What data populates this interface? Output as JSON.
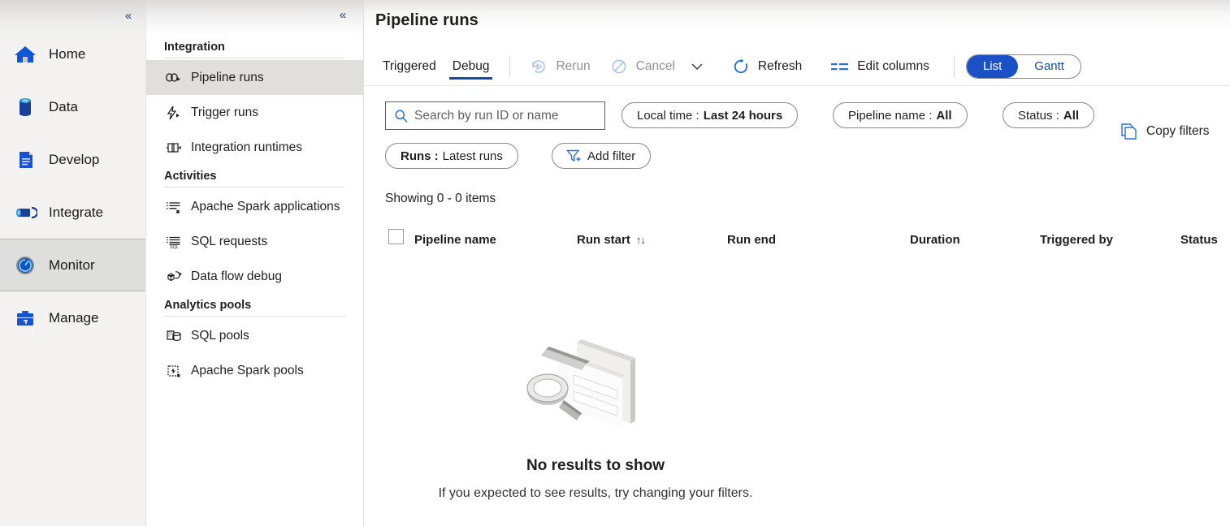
{
  "rail": {
    "collapse_icon": "chevron-double-left-icon",
    "items": [
      {
        "label": "Home",
        "icon": "home-icon",
        "selected": false
      },
      {
        "label": "Data",
        "icon": "database-icon",
        "selected": false
      },
      {
        "label": "Develop",
        "icon": "document-icon",
        "selected": false
      },
      {
        "label": "Integrate",
        "icon": "pipeline-icon",
        "selected": false
      },
      {
        "label": "Monitor",
        "icon": "monitor-gauge-icon",
        "selected": true
      },
      {
        "label": "Manage",
        "icon": "toolbox-icon",
        "selected": false
      }
    ]
  },
  "pane": {
    "collapse_icon": "chevron-double-left-icon",
    "groups": [
      {
        "title": "Integration",
        "items": [
          {
            "label": "Pipeline runs",
            "icon": "pipeline-runs-icon",
            "selected": true
          },
          {
            "label": "Trigger runs",
            "icon": "trigger-runs-icon",
            "selected": false
          },
          {
            "label": "Integration runtimes",
            "icon": "integration-runtimes-icon",
            "selected": false
          }
        ]
      },
      {
        "title": "Activities",
        "items": [
          {
            "label": "Apache Spark applications",
            "icon": "spark-applications-icon",
            "selected": false
          },
          {
            "label": "SQL requests",
            "icon": "sql-requests-icon",
            "selected": false
          },
          {
            "label": "Data flow debug",
            "icon": "data-flow-debug-icon",
            "selected": false
          }
        ]
      },
      {
        "title": "Analytics pools",
        "items": [
          {
            "label": "SQL pools",
            "icon": "sql-pools-icon",
            "selected": false
          },
          {
            "label": "Apache Spark pools",
            "icon": "spark-pools-icon",
            "selected": false
          }
        ]
      }
    ]
  },
  "header": {
    "title": "Pipeline runs"
  },
  "toolbar": {
    "tabs": [
      {
        "label": "Triggered",
        "active": false
      },
      {
        "label": "Debug",
        "active": true
      }
    ],
    "rerun_label": "Rerun",
    "rerun_icon": "rerun-icon",
    "rerun_disabled": true,
    "cancel_label": "Cancel",
    "cancel_icon": "cancel-circle-icon",
    "cancel_disabled": true,
    "cancel_chevron_icon": "chevron-down-icon",
    "refresh_label": "Refresh",
    "refresh_icon": "refresh-icon",
    "edit_columns_label": "Edit columns",
    "edit_columns_icon": "edit-columns-icon",
    "view_toggle": {
      "list_label": "List",
      "gantt_label": "Gantt",
      "selected": "List"
    }
  },
  "filters": {
    "search_placeholder": "Search by run ID or name",
    "search_value": "",
    "search_icon": "search-icon",
    "time_filter": {
      "label": "Local time :",
      "value": "Last 24 hours"
    },
    "pipeline_filter": {
      "label": "Pipeline name :",
      "value": "All"
    },
    "status_filter": {
      "label": "Status :",
      "value": "All"
    },
    "runs_filter": {
      "label": "Runs :",
      "value": "Latest runs"
    },
    "add_filter_label": "Add filter",
    "add_filter_icon": "funnel-plus-icon",
    "copy_filters_label": "Copy filters",
    "copy_filters_icon": "copy-pages-icon"
  },
  "table": {
    "showing_text": "Showing 0 - 0 items",
    "select_all_checked": false,
    "columns": [
      {
        "label": "Pipeline name",
        "sort": ""
      },
      {
        "label": "Run start",
        "sort": "↑↓"
      },
      {
        "label": "Run end",
        "sort": ""
      },
      {
        "label": "Duration",
        "sort": ""
      },
      {
        "label": "Triggered by",
        "sort": ""
      },
      {
        "label": "Status",
        "sort": ""
      }
    ],
    "rows": []
  },
  "empty_state": {
    "illustration": "magnifier-over-document-illustration",
    "title": "No results to show",
    "subtitle": "If you expected to see results, try changing your filters."
  },
  "colors": {
    "accent_blue": "#1a51c6",
    "tab_underline": "#0f4bb3",
    "icon_blue": "#0f56d7",
    "rail_bg": "#f3f2f1",
    "selected_grey": "#e1dfdd",
    "disabled_text": "#919191"
  }
}
